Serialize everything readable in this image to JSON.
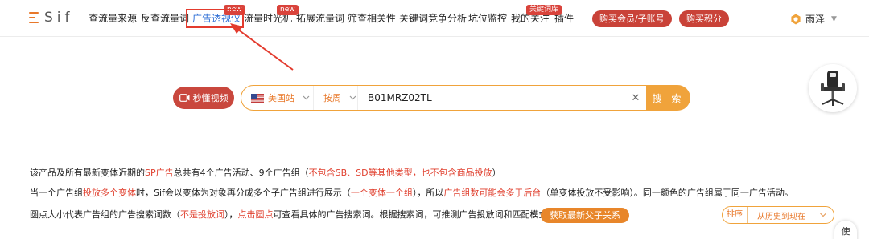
{
  "logo": {
    "text": "Sif"
  },
  "nav": {
    "items": [
      {
        "label": "查流量来源"
      },
      {
        "label": "反查流量词"
      },
      {
        "label": "广告透视仪",
        "badge": "new",
        "active": true
      },
      {
        "label": "流量时光机",
        "badge": "new"
      },
      {
        "label": "拓展流量词"
      },
      {
        "label": "筛查相关性"
      },
      {
        "label": "关键词竞争分析"
      },
      {
        "label": "坑位监控"
      },
      {
        "label": "我的关注"
      },
      {
        "label": "插件",
        "badge": "关键词库"
      }
    ],
    "buy_member": "购买会员/子账号",
    "buy_points": "购买积分",
    "user_name": "雨泽"
  },
  "search": {
    "video_btn": "秒懂视频",
    "site": "美国站",
    "period": "按周",
    "query": "B01MRZ02TL",
    "submit": "搜 索"
  },
  "info": {
    "line1": [
      {
        "t": "该产品及所有最新变体近期的",
        "red": false
      },
      {
        "t": "SP广告",
        "red": true
      },
      {
        "t": "总共有4个广告活动、9个广告组（",
        "red": false
      },
      {
        "t": "不包含SB、SD等其他类型，也不包含商品投放",
        "red": true
      },
      {
        "t": "）",
        "red": false
      }
    ],
    "line2": [
      {
        "t": "当一个广告组",
        "red": false
      },
      {
        "t": "投放多个变体",
        "red": true
      },
      {
        "t": "时，Sif会以变体为对象再分成多个子广告组进行展示（",
        "red": false
      },
      {
        "t": "一个变体一个组",
        "red": true
      },
      {
        "t": "），所以",
        "red": false
      },
      {
        "t": "广告组数可能会多于后台",
        "red": true
      },
      {
        "t": "（单变体投放不受影响）。同一颜色的广告组属于同一广告活动。",
        "red": false
      }
    ],
    "line3": [
      {
        "t": "圆点大小代表广告组的广告搜索词数（",
        "red": false
      },
      {
        "t": "不是投放词",
        "red": true
      },
      {
        "t": "），",
        "red": false
      },
      {
        "t": "点击圆点",
        "red": true
      },
      {
        "t": "可查看具体的广告搜索词。根据搜索词，可推测广告投放词和匹配模式。",
        "red": false
      }
    ],
    "fetch_btn": "获取最新父子关系"
  },
  "sort": {
    "label": "排序",
    "value": "从历史到现在"
  },
  "side_tab": "使",
  "colors": {
    "accent": "#f0a33b",
    "brand_red": "#c94238",
    "link_blue": "#2f6fd6",
    "annotation_red": "#e33b2e"
  }
}
